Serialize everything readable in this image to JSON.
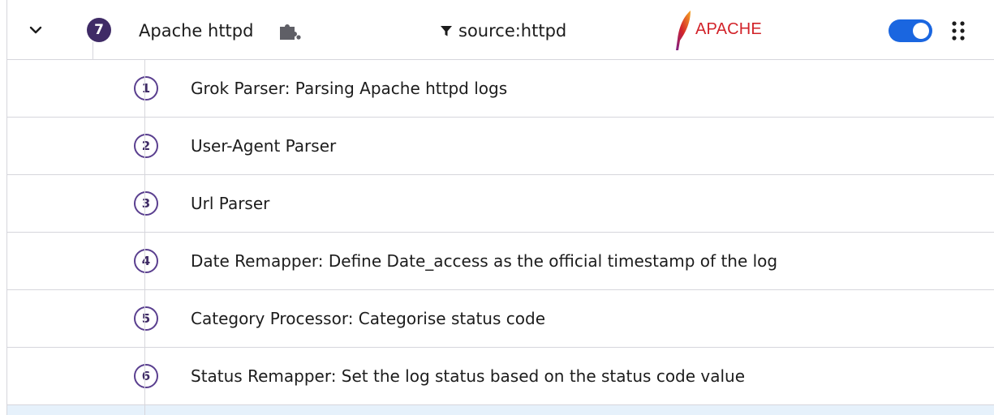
{
  "pipeline": {
    "processor_count": "7",
    "name": "Apache httpd",
    "filter_query": "source:httpd",
    "integration_logo_text": "APACHE",
    "enabled": true,
    "colors": {
      "accent_toggle": "#1a66e0",
      "badge": "#3f2b66",
      "logo_red": "#d2232a",
      "row_highlight": "#e6f1fb"
    },
    "icons": {
      "expand": "chevron-down-icon",
      "integration": "puzzle-icon",
      "filter": "filter-icon",
      "drag": "drag-handle-icon"
    }
  },
  "processors": [
    {
      "number": "1",
      "name": "Grok Parser: Parsing Apache httpd logs"
    },
    {
      "number": "2",
      "name": "User-Agent Parser"
    },
    {
      "number": "3",
      "name": "Url Parser"
    },
    {
      "number": "4",
      "name": "Date Remapper: Define Date_access as the official timestamp of the log"
    },
    {
      "number": "5",
      "name": "Category Processor: Categorise status code"
    },
    {
      "number": "6",
      "name": "Status Remapper: Set the log status based on the status code value"
    }
  ]
}
